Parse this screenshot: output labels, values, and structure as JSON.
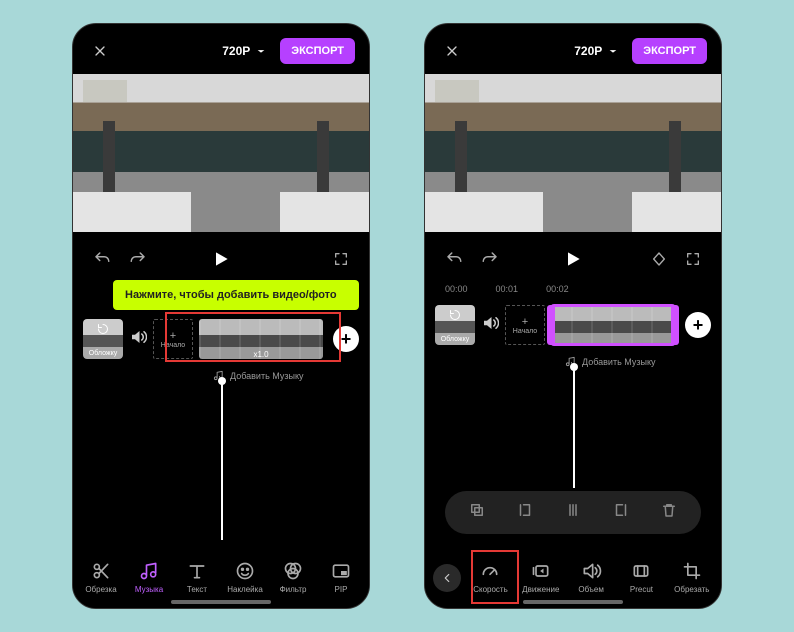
{
  "topbar": {
    "resolution": "720P",
    "export": "ЭКСПОРТ"
  },
  "hint": "Нажмите, чтобы добавить видео/фото",
  "timeline": {
    "cover_label": "Обложку",
    "start_label": "Начало",
    "clip_speed": "x1.0",
    "music_label": "Добавить Музыку"
  },
  "time_labels": [
    "00:00",
    "00:01",
    "00:02"
  ],
  "tools_left": {
    "crop": "Обрезка",
    "music": "Музыка",
    "text": "Текст",
    "sticker": "Наклейка",
    "filter": "Фильтр",
    "pip": "PIP"
  },
  "tools_right": {
    "speed": "Скорость",
    "motion": "Движение",
    "volume": "Объем",
    "precut": "Precut",
    "crop2": "Обрезать"
  }
}
